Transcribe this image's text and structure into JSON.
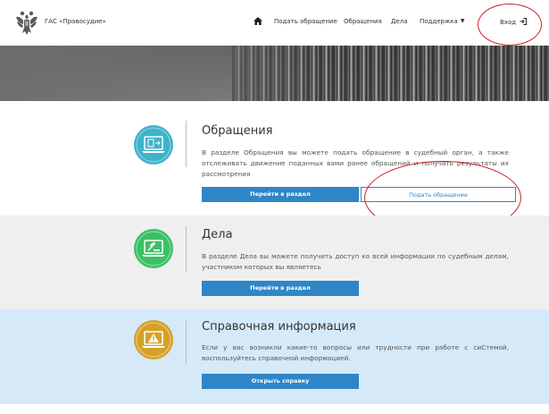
{
  "header": {
    "brand": "ГАС «Правосудие»",
    "nav": {
      "submit_appeal": "Подать обращение",
      "appeals": "Обращения",
      "cases": "Дела",
      "support": "Поддержка"
    },
    "login": "Вход"
  },
  "sections": [
    {
      "title": "Обращения",
      "description": "В разделе Обращения вы можете подать обращение в судебный орган, а также отслеживать движение поданных вами ранее обращений и получать результаты их рассмотрения",
      "primary_button": "Перейти в раздел",
      "secondary_button": "Подать обращение",
      "icon": "laptop-document-icon",
      "color": "#3fb3c9"
    },
    {
      "title": "Дела",
      "description": "В разделе Дела вы можете получить доступ ко всей информации по судебным делам, участником которых вы являетесь",
      "primary_button": "Перейти в раздел",
      "icon": "laptop-gavel-icon",
      "color": "#3cc065"
    },
    {
      "title": "Справочная информация",
      "description": "Если у вас возникли какие-то вопросы или трудности при работе с сиСтемой, воспользуйтесь справочной информацией.",
      "primary_button": "Открыть справку",
      "icon": "laptop-warning-icon",
      "color": "#d6a128"
    }
  ],
  "colors": {
    "primary_button": "#2f86c6",
    "annotation": "#cc1f2b"
  }
}
